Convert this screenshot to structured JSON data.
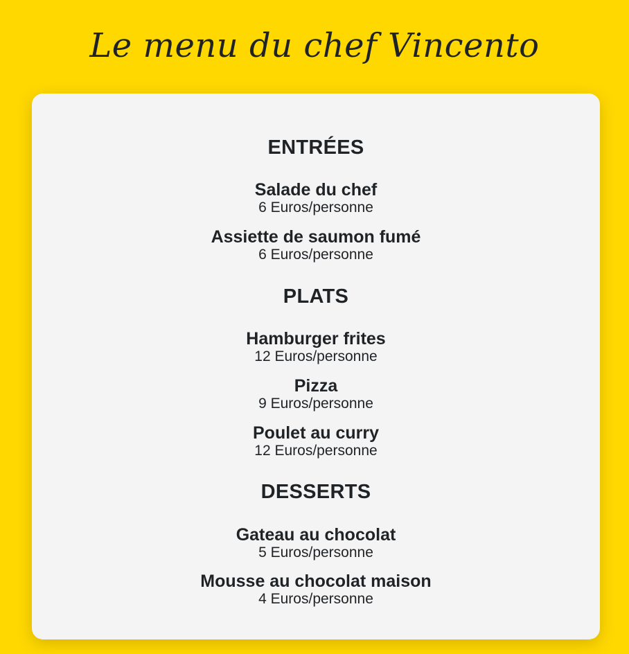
{
  "page": {
    "title": "Le menu du chef Vincento"
  },
  "colors": {
    "background": "#FFD800",
    "card": "#F5F4F5",
    "text": "#1F2326"
  },
  "menu": {
    "sections": [
      {
        "title": "ENTRÉES",
        "dishes": [
          {
            "name": "Salade du chef",
            "price": "6 Euros/personne"
          },
          {
            "name": "Assiette de saumon fumé",
            "price": "6 Euros/personne"
          }
        ]
      },
      {
        "title": "PLATS",
        "dishes": [
          {
            "name": "Hamburger frites",
            "price": "12 Euros/personne"
          },
          {
            "name": "Pizza",
            "price": "9 Euros/personne"
          },
          {
            "name": "Poulet au curry",
            "price": "12 Euros/personne"
          }
        ]
      },
      {
        "title": "DESSERTS",
        "dishes": [
          {
            "name": "Gateau au chocolat",
            "price": "5 Euros/personne"
          },
          {
            "name": "Mousse au chocolat maison",
            "price": "4 Euros/personne"
          }
        ]
      }
    ]
  }
}
